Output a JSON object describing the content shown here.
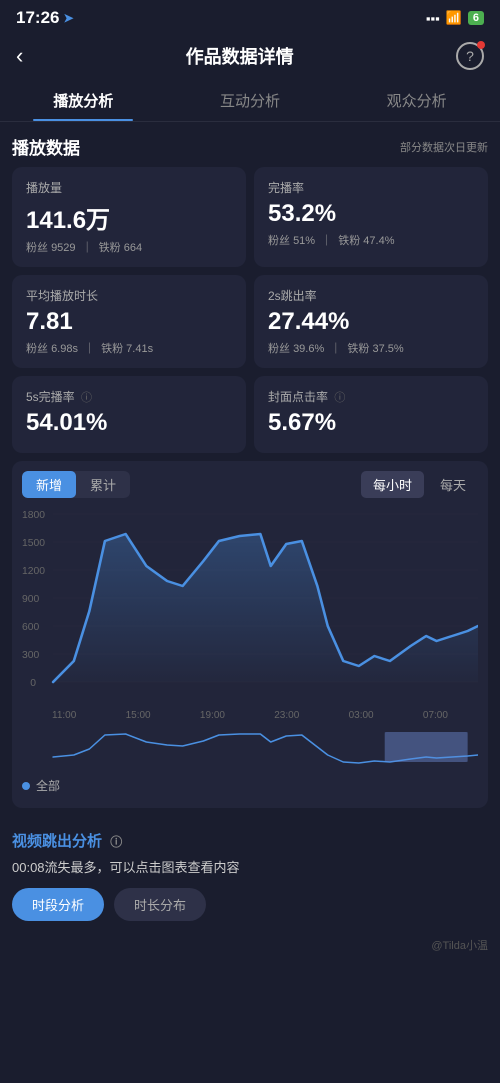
{
  "statusBar": {
    "time": "17:26",
    "battery": "6",
    "locationIcon": "➤"
  },
  "header": {
    "back": "‹",
    "title": "作品数据详情",
    "helpLabel": "?"
  },
  "tabs": [
    {
      "id": "play",
      "label": "播放分析",
      "active": true
    },
    {
      "id": "interact",
      "label": "互动分析",
      "active": false
    },
    {
      "id": "audience",
      "label": "观众分析",
      "active": false
    }
  ],
  "sectionTitle": "播放数据",
  "sectionNote": "部分数据次日更新",
  "stats": [
    {
      "label": "播放量",
      "value": "141.6万",
      "sub1_label": "粉丝",
      "sub1_value": "9529",
      "sub2_label": "铁粉",
      "sub2_value": "664"
    },
    {
      "label": "完播率",
      "value": "53.2%",
      "sub1_label": "粉丝",
      "sub1_value": "51%",
      "sub2_label": "铁粉",
      "sub2_value": "47.4%"
    },
    {
      "label": "平均播放时长",
      "value": "7.81",
      "sub1_label": "粉丝",
      "sub1_value": "6.98s",
      "sub2_label": "铁粉",
      "sub2_value": "7.41s"
    },
    {
      "label": "2s跳出率",
      "value": "27.44%",
      "sub1_label": "粉丝",
      "sub1_value": "39.6%",
      "sub2_label": "铁粉",
      "sub2_value": "37.5%"
    },
    {
      "label": "5s完播率",
      "value": "54.01%",
      "hasInfo": true
    },
    {
      "label": "封面点击率",
      "value": "5.67%",
      "hasInfo": true
    }
  ],
  "chart": {
    "toggles": [
      "新增",
      "累计"
    ],
    "activeToggle": "新增",
    "timeBtns": [
      "每小时",
      "每天"
    ],
    "activeTime": "每小时",
    "yLabels": [
      "1800",
      "1500",
      "1200",
      "900",
      "600",
      "300",
      "0"
    ],
    "xLabels": [
      "11:00",
      "15:00",
      "19:00",
      "23:00",
      "03:00",
      "07:00"
    ]
  },
  "legend": "全部",
  "jumpSection": {
    "title": "视频跳出分析",
    "desc": "00:08流失最多，可以点击图表查看内容",
    "buttons": [
      "时段分析",
      "时长分布"
    ],
    "activeBtn": "时段分析"
  },
  "watermark": "@Tilda小温"
}
